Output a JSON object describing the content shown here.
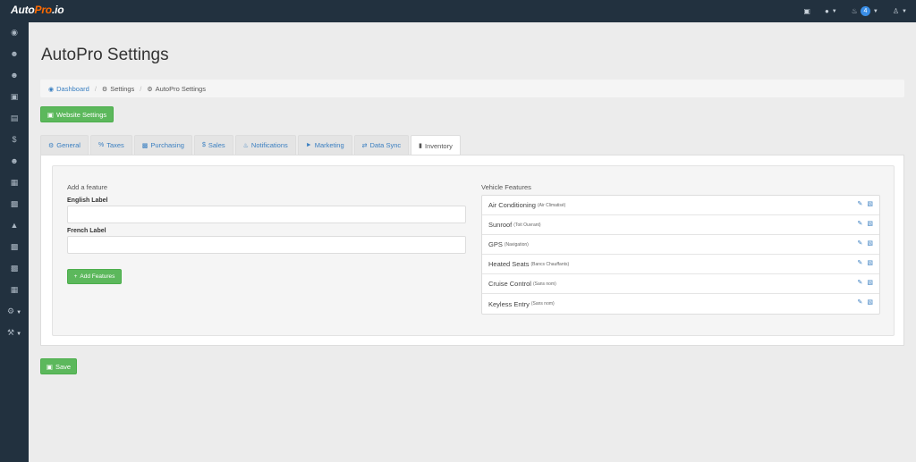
{
  "navbar": {
    "brand_part1": "Auto",
    "brand_part2": "Pro",
    "brand_part3": ".io",
    "brand_color": "#ff6a00",
    "notifications_count": "4",
    "icons": [
      "desktop-icon",
      "comments-icon",
      "bell-icon",
      "user-icon"
    ]
  },
  "sidebar": {
    "icons": [
      "dashboard-icon",
      "users-icon",
      "users-icon",
      "car-icon",
      "id-card-icon",
      "dollar-icon",
      "users-icon",
      "calendar-icon",
      "money-icon",
      "bank-icon",
      "money-icon",
      "bar-chart-icon",
      "table-icon",
      "gear-icon",
      "wrench-icon"
    ]
  },
  "page": {
    "title": "AutoPro Settings"
  },
  "breadcrumb": {
    "dashboard": "Dashboard",
    "settings": "Settings",
    "current": "AutoPro Settings"
  },
  "buttons": {
    "website_settings": "Website Settings",
    "add_features": "Add Features",
    "save": "Save"
  },
  "tabs": [
    {
      "label": "General",
      "icon": "gear-icon"
    },
    {
      "label": "Taxes",
      "icon": "percent-icon"
    },
    {
      "label": "Purchasing",
      "icon": "money-icon"
    },
    {
      "label": "Sales",
      "icon": "dollar-icon"
    },
    {
      "label": "Notifications",
      "icon": "bell-icon"
    },
    {
      "label": "Marketing",
      "icon": "bullhorn-icon"
    },
    {
      "label": "Data Sync",
      "icon": "random-icon"
    },
    {
      "label": "Inventory",
      "icon": "book-icon"
    }
  ],
  "add_feature": {
    "title": "Add a feature",
    "english_label": "English Label",
    "english_value": "",
    "french_label": "French Label",
    "french_value": ""
  },
  "vehicle_features": {
    "title": "Vehicle Features",
    "items": [
      {
        "name": "Air Conditioning",
        "french": "(Air Climatisé)"
      },
      {
        "name": "Sunroof",
        "french": "(Toit Ouvrant)"
      },
      {
        "name": "GPS",
        "french": "(Navigation)"
      },
      {
        "name": "Heated Seats",
        "french": "(Bancs Chauffants)"
      },
      {
        "name": "Cruise Control",
        "french": "(Sans nom)"
      },
      {
        "name": "Keyless Entry",
        "french": "(Sans nom)"
      }
    ]
  },
  "colors": {
    "navbar": "#22313f",
    "accent_green": "#5cb85c",
    "link_blue": "#3a7fc1"
  }
}
